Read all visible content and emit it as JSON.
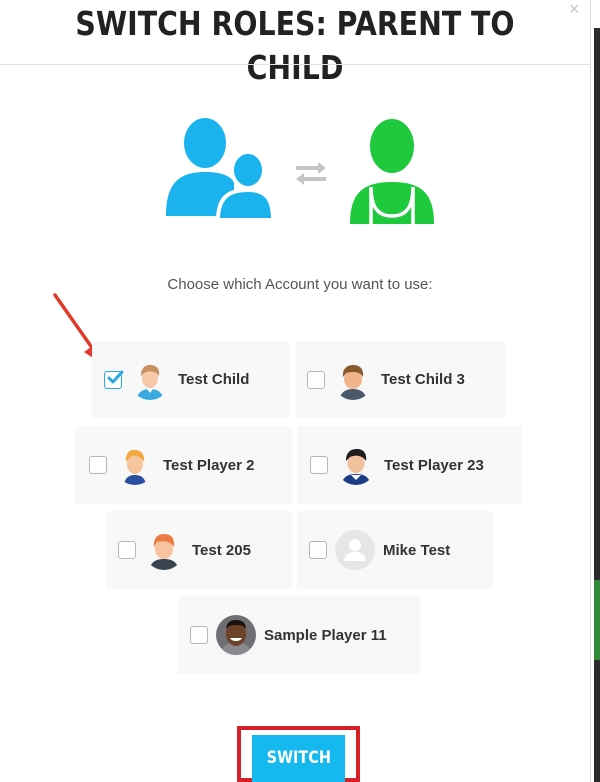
{
  "modal": {
    "title": "SWITCH ROLES: PARENT TO CHILD",
    "close_icon": "×",
    "prompt": "Choose which Account you want to use:"
  },
  "hero": {
    "parent_icon": "parent-group-icon",
    "swap_icon": "swap-arrows-icon",
    "child_icon": "child-player-icon",
    "parent_color": "#1ab3ee",
    "child_color": "#1ec93c"
  },
  "accounts": [
    {
      "name": "Test Child",
      "checked": true,
      "avatar": "boy-light-hair"
    },
    {
      "name": "Test Child 3",
      "checked": false,
      "avatar": "boy-brown-hair"
    },
    {
      "name": "Test Player 2",
      "checked": false,
      "avatar": "boy-blond-hair"
    },
    {
      "name": "Test Player 23",
      "checked": false,
      "avatar": "boy-black-hair"
    },
    {
      "name": "Test 205",
      "checked": false,
      "avatar": "boy-red-hair"
    },
    {
      "name": "Mike Test",
      "checked": false,
      "avatar": "default-user"
    },
    {
      "name": "Sample Player 11",
      "checked": false,
      "avatar": "photo-player"
    }
  ],
  "switch_button": {
    "label": "SWITCH"
  },
  "colors": {
    "accent": "#15b9f0",
    "checkbox": "#2ba8e0",
    "highlight": "#d61f26"
  }
}
